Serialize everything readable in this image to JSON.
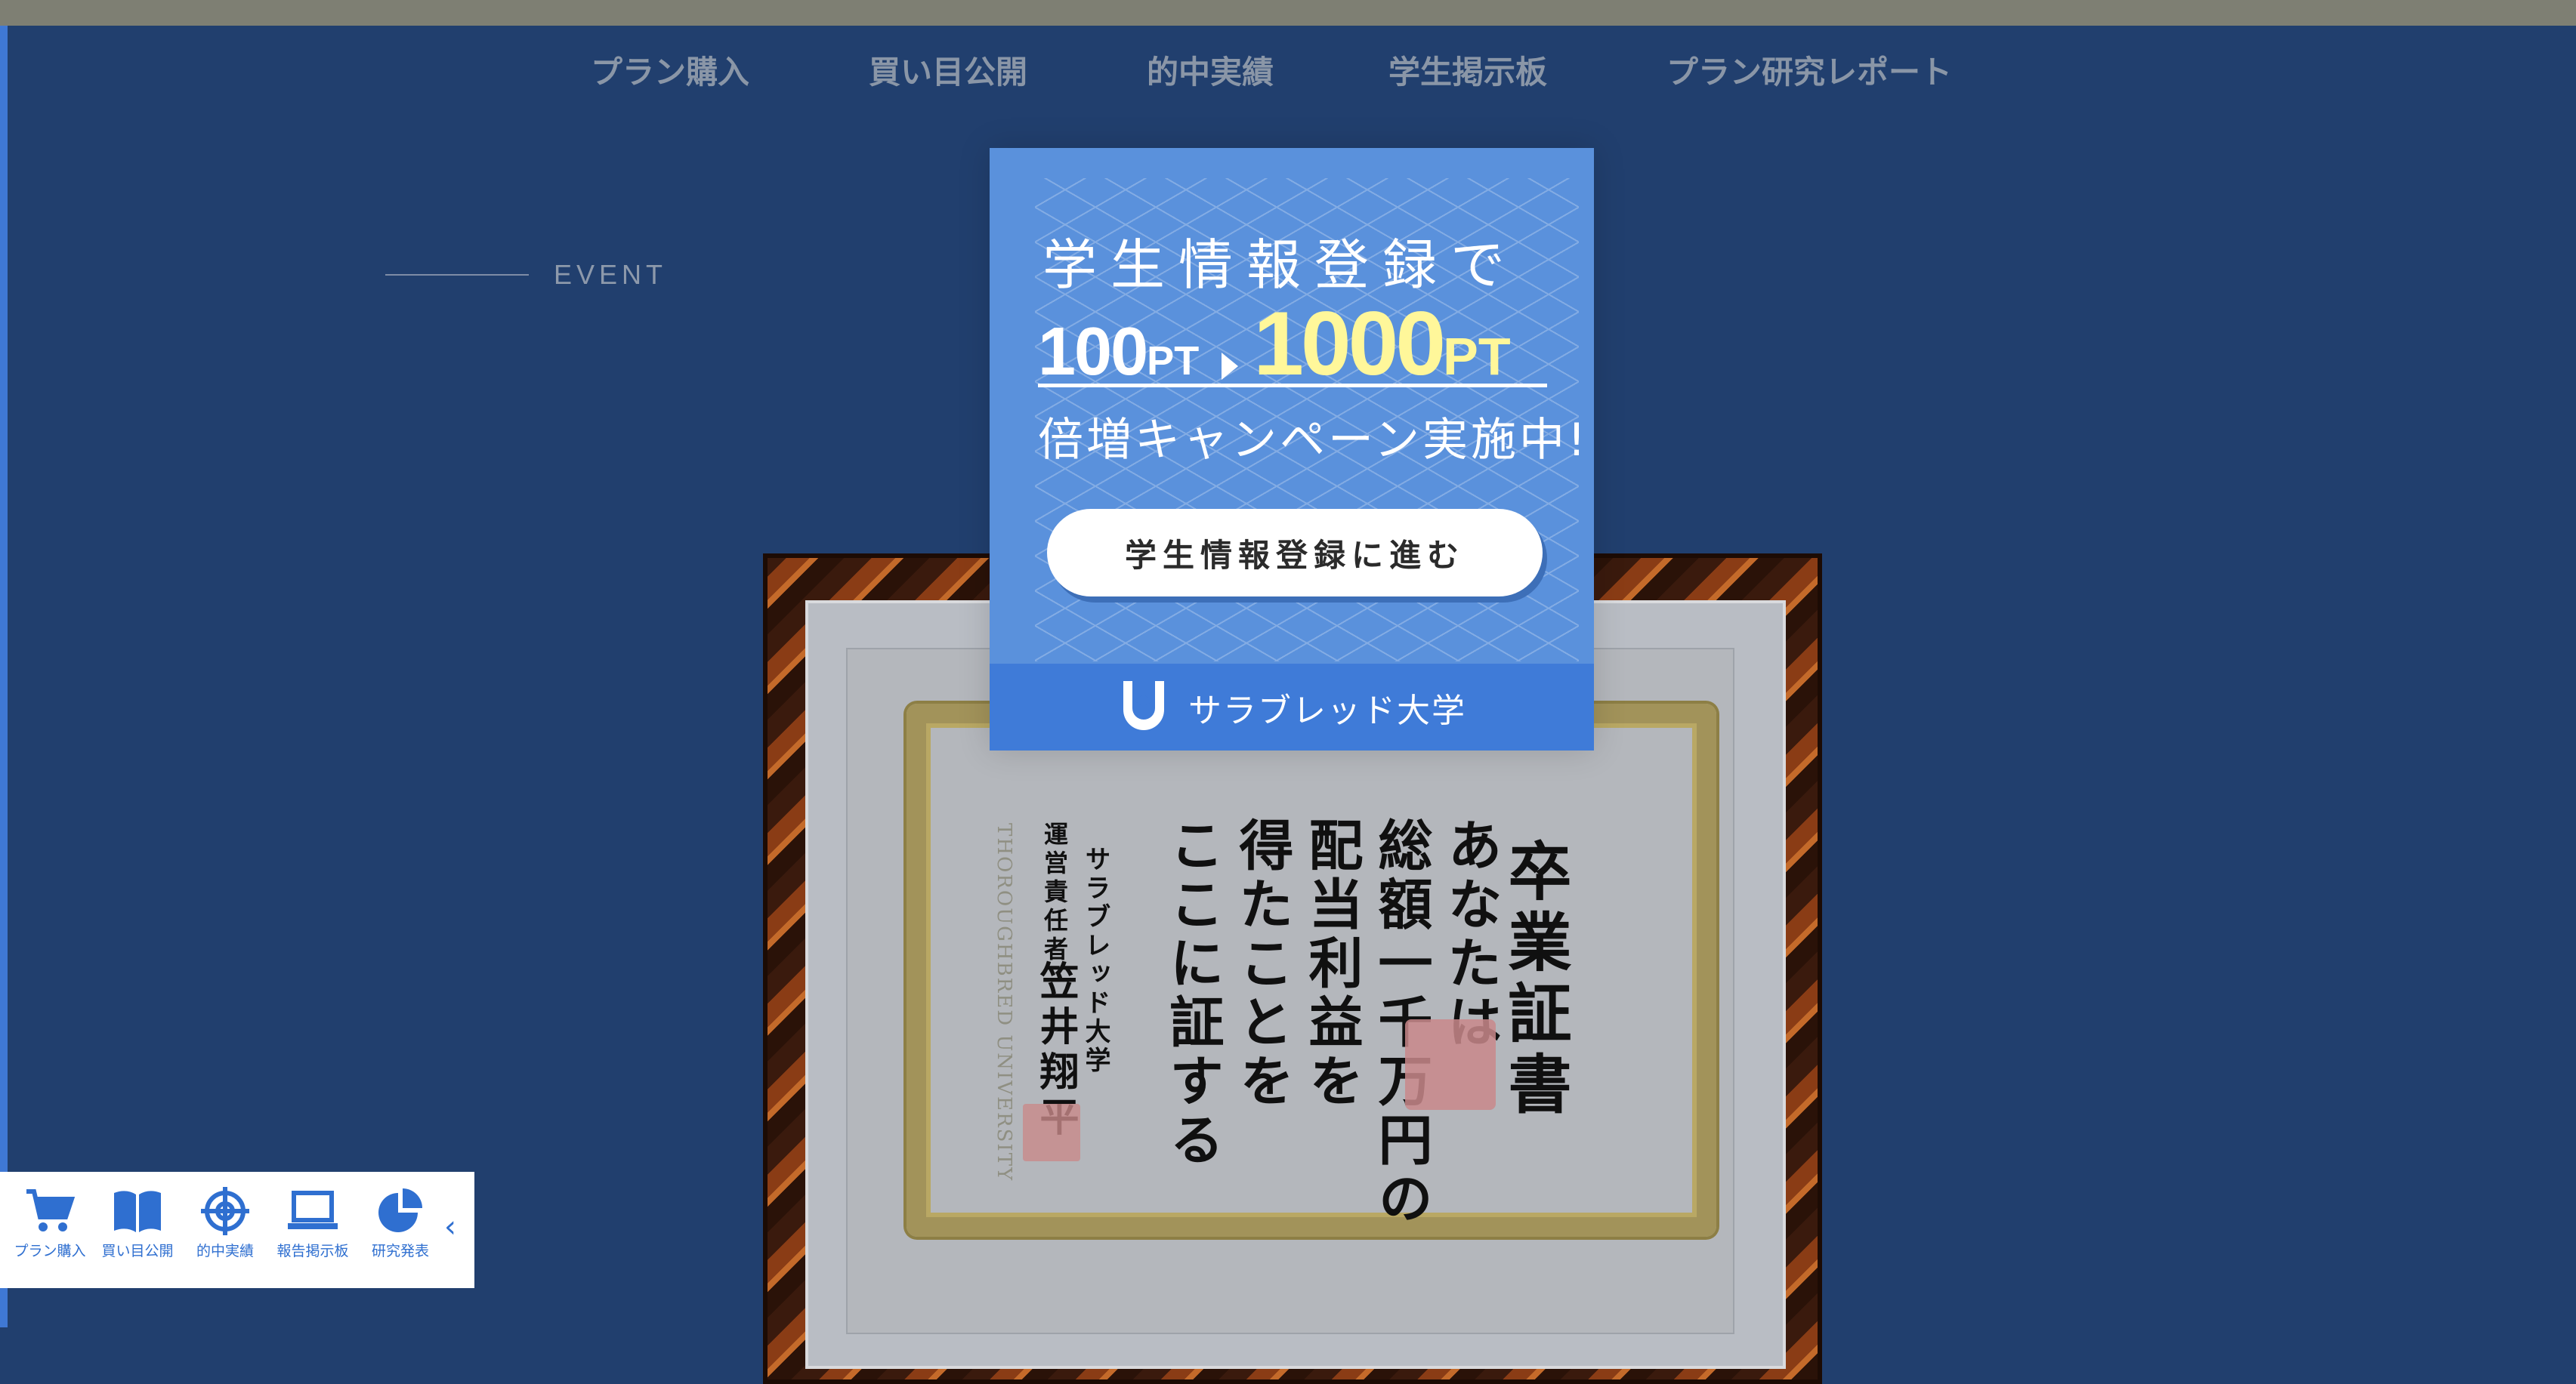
{
  "nav": {
    "items": [
      "プラン購入",
      "買い目公開",
      "的中実績",
      "学生掲示板",
      "プラン研究レポート"
    ]
  },
  "event": {
    "label": "EVENT"
  },
  "certificate": {
    "title": "卒業証書",
    "body": [
      "あなたは",
      "総額一千万円の",
      "配当利益を",
      "得たことを",
      "ここに証する"
    ],
    "university": "サラブレッド大学",
    "role": "運営責任者",
    "name": "笠井翔平",
    "english": "THOROUGHBRED UNIVERSITY"
  },
  "popup": {
    "line1": "学生情報登録で",
    "from_points": "100",
    "from_unit": "PT",
    "to_points": "1000",
    "to_unit": "PT",
    "line3": "倍増キャンペーン実施中!",
    "button_label": "学生情報登録に進む",
    "brand": "サラブレッド大学",
    "colors": {
      "background": "#5a91dc",
      "footer": "#3f7bd8",
      "highlight": "#fff79a"
    }
  },
  "toolbar": {
    "items": [
      {
        "label": "プラン購入",
        "icon": "cart-icon"
      },
      {
        "label": "買い目公開",
        "icon": "book-icon"
      },
      {
        "label": "的中実績",
        "icon": "target-icon"
      },
      {
        "label": "報告掲示板",
        "icon": "laptop-icon"
      },
      {
        "label": "研究発表",
        "icon": "pie-chart-icon"
      }
    ],
    "collapse_icon": "chevron-left-icon"
  },
  "colors": {
    "page_background": "#213f6e",
    "accent": "#2f6fd0"
  }
}
